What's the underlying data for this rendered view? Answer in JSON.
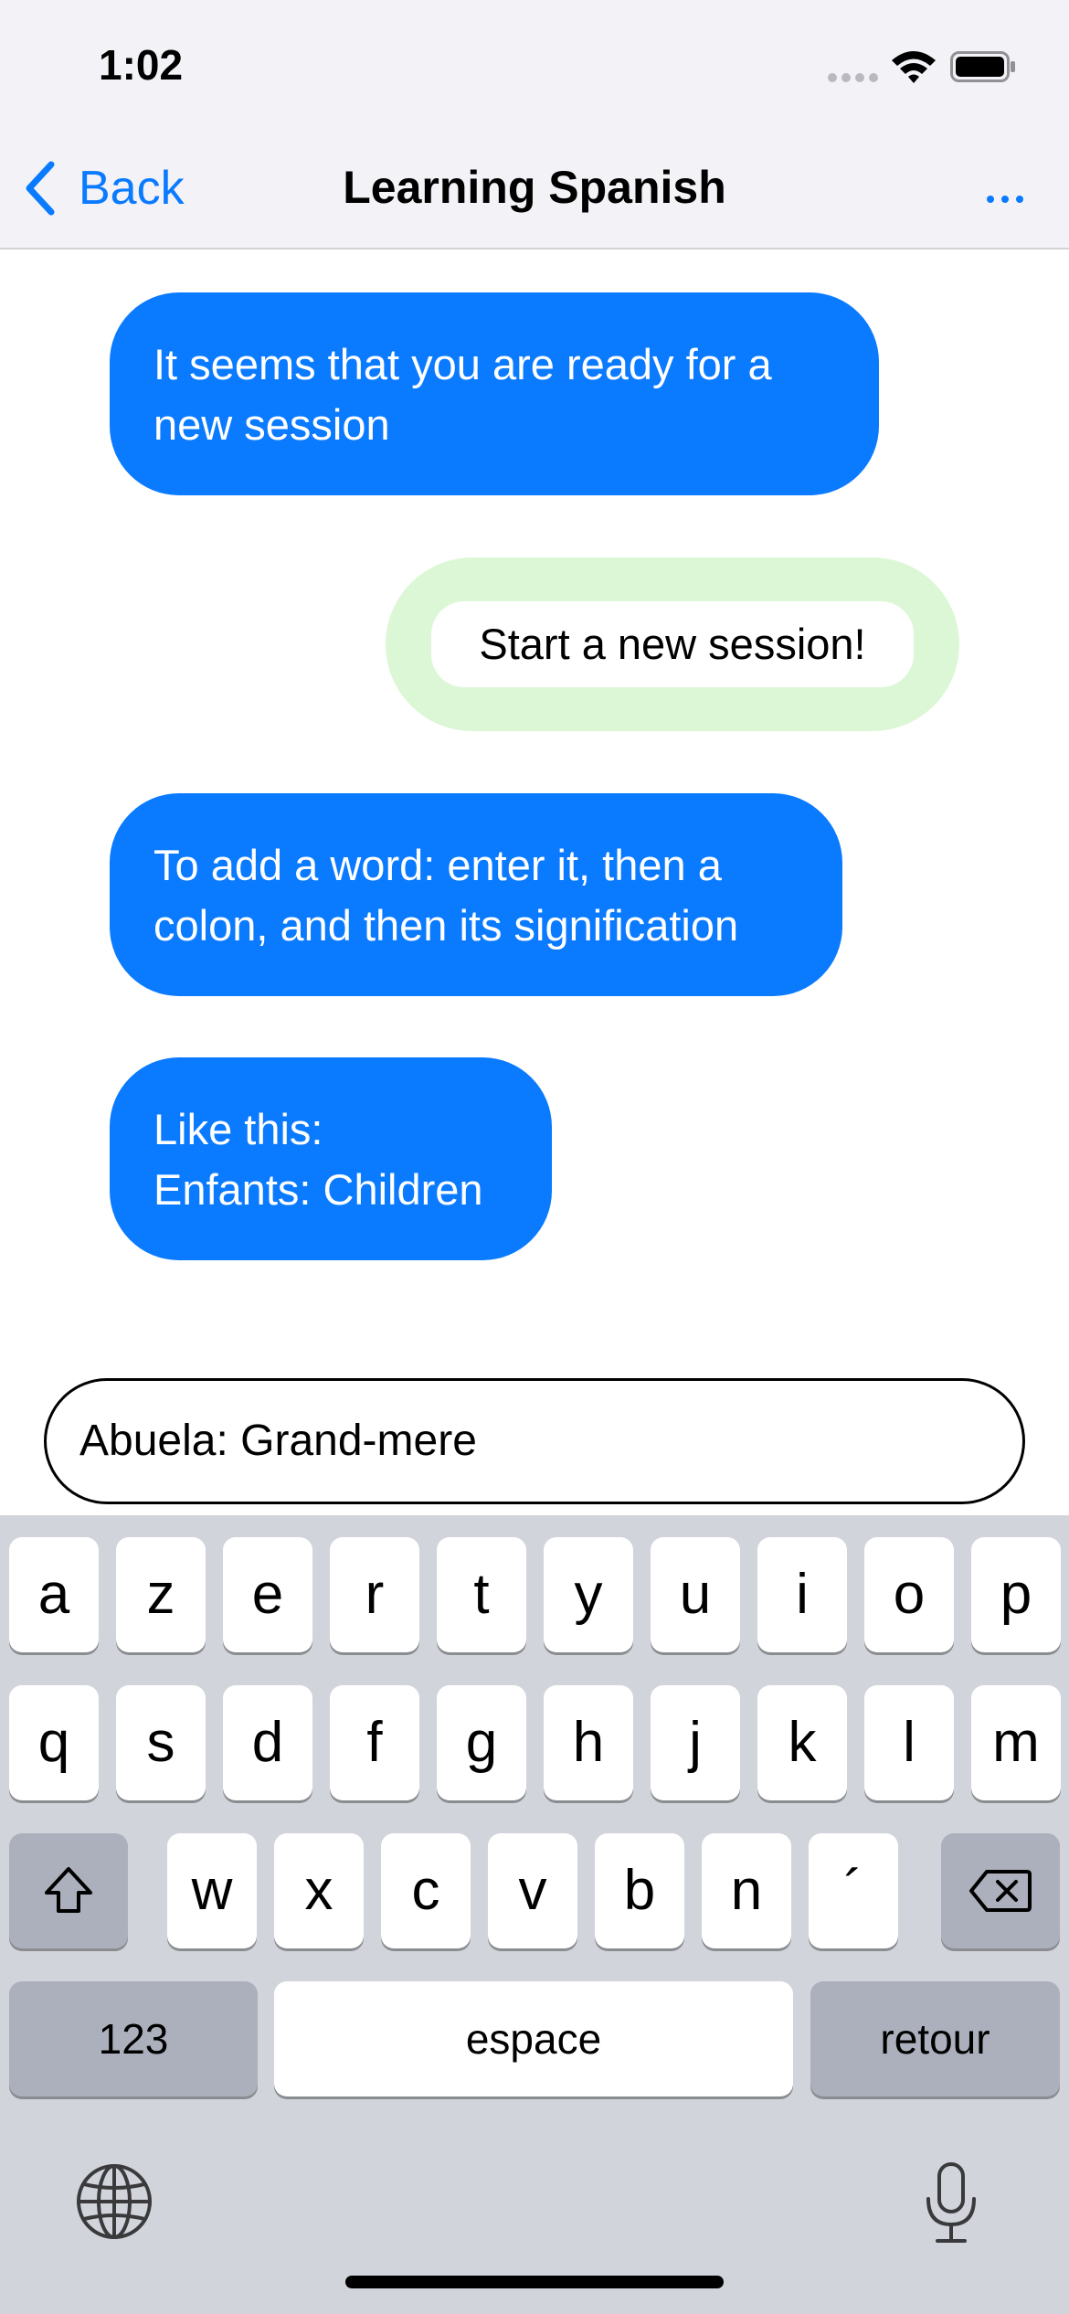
{
  "status_bar": {
    "time": "1:02"
  },
  "nav": {
    "back_label": "Back",
    "title": "Learning Spanish",
    "more_label": "..."
  },
  "messages": [
    {
      "sender": "bot",
      "text": "It seems that you are ready for a\nnew session"
    },
    {
      "sender": "user",
      "text": "Start a new session!"
    },
    {
      "sender": "bot",
      "text": "To add a word: enter it, then a\ncolon, and then its signification"
    },
    {
      "sender": "bot",
      "text": "Like this:\nEnfants: Children"
    }
  ],
  "input": {
    "value": "Abuela: Grand-mere"
  },
  "keyboard": {
    "row1": [
      "a",
      "z",
      "e",
      "r",
      "t",
      "y",
      "u",
      "i",
      "o",
      "p"
    ],
    "row2": [
      "q",
      "s",
      "d",
      "f",
      "g",
      "h",
      "j",
      "k",
      "l",
      "m"
    ],
    "row3": [
      "w",
      "x",
      "c",
      "v",
      "b",
      "n",
      "´"
    ],
    "numbers_label": "123",
    "space_label": "espace",
    "return_label": "retour",
    "icons": {
      "shift": "shift-icon",
      "delete": "delete-icon",
      "globe": "globe-icon",
      "mic": "microphone-icon"
    }
  },
  "colors": {
    "accent": "#0a7aff",
    "user_bubble": "#dcf7d6",
    "keyboard_bg": "#d1d4db",
    "dark_key": "#abb0bc"
  }
}
